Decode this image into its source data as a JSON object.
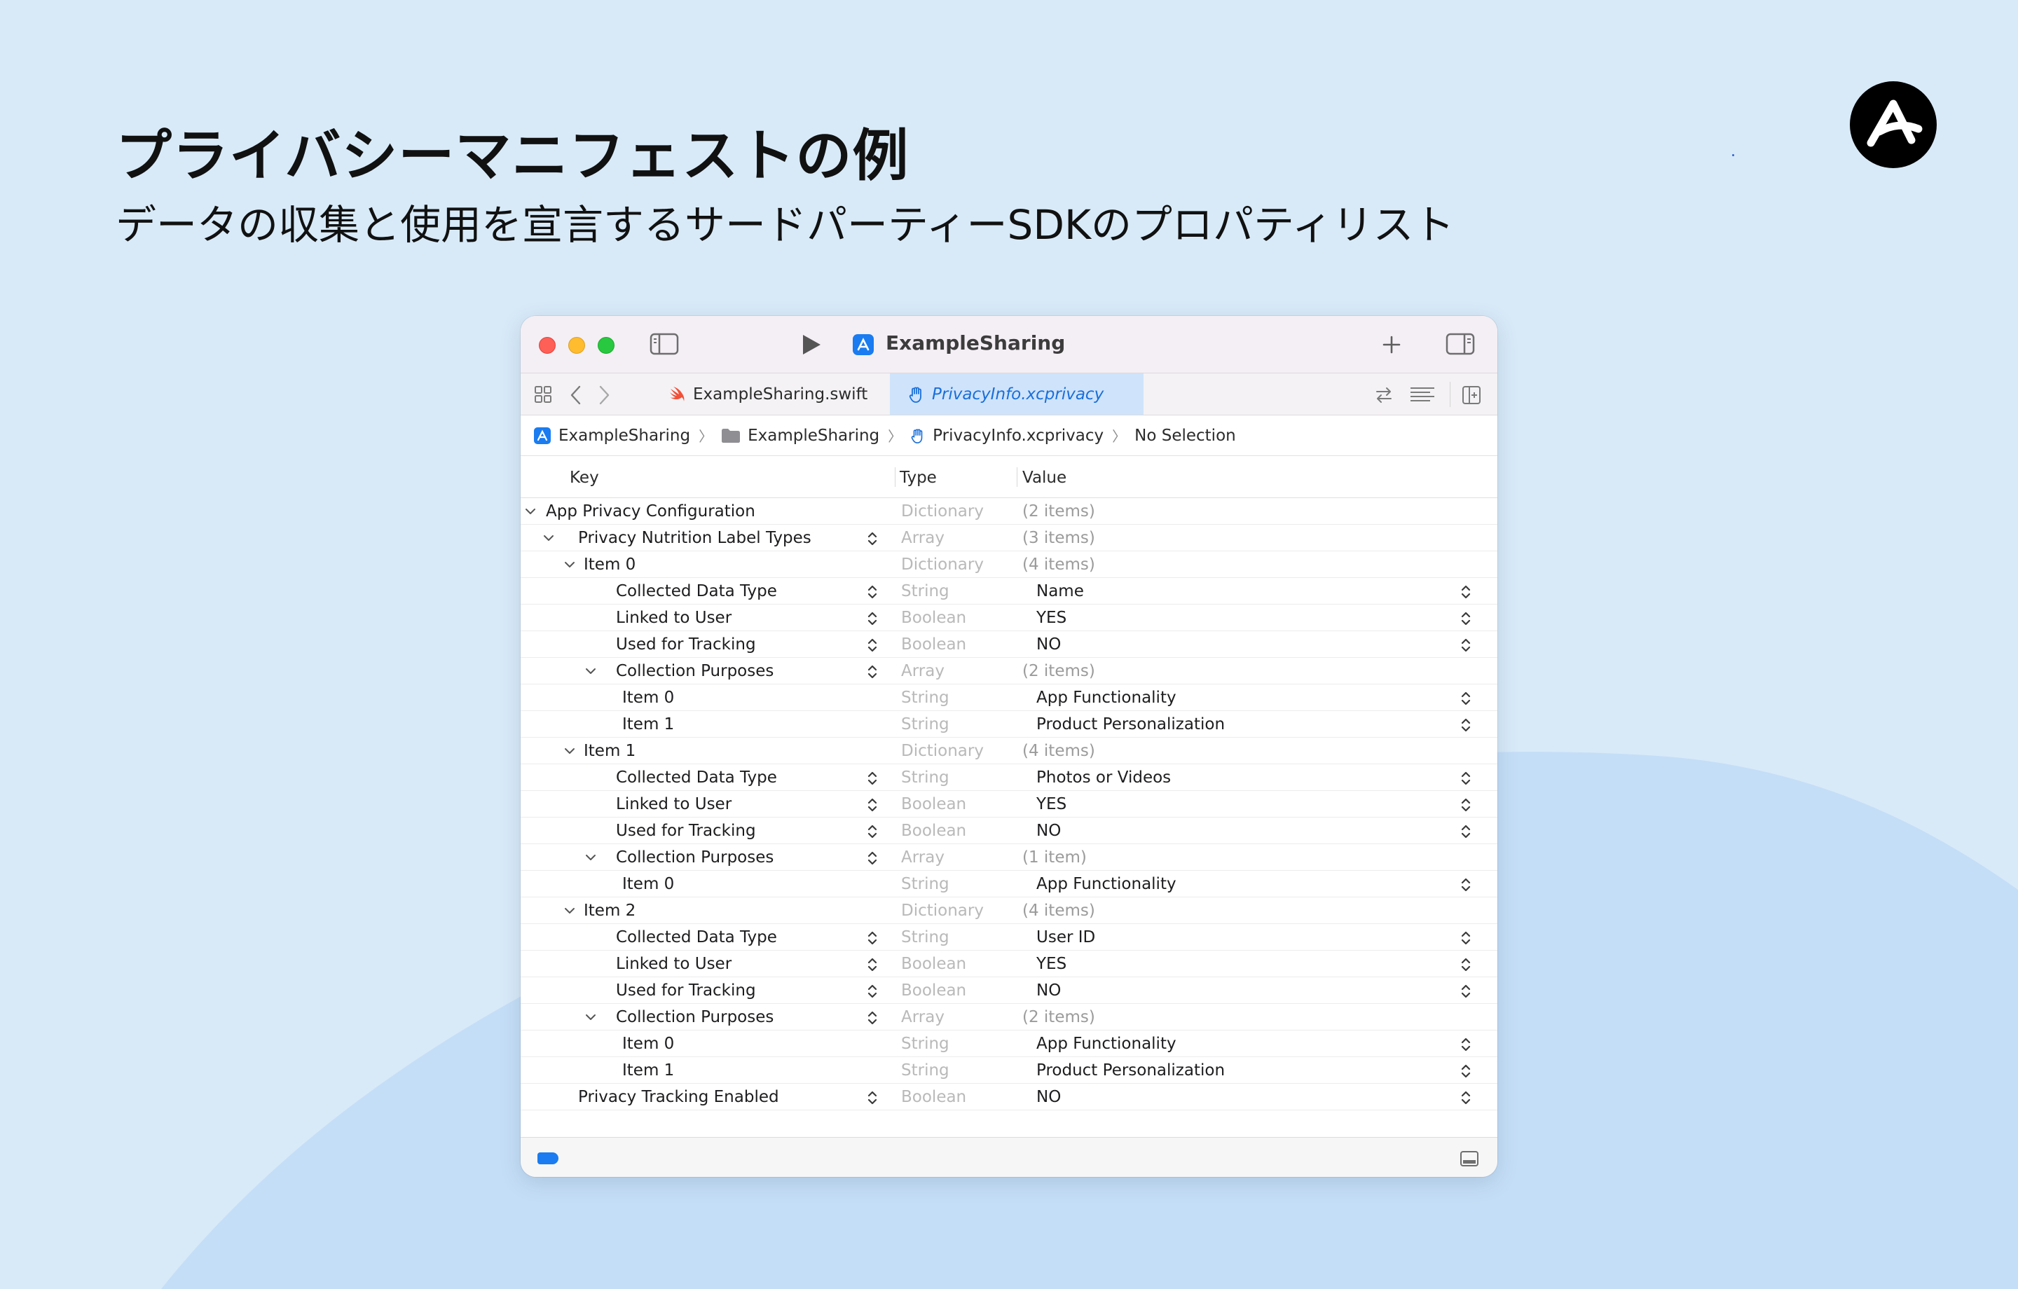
{
  "slide": {
    "title": "プライバシーマニフェストの例",
    "subtitle": "データの収集と使用を宣言するサードパーティーSDKのプロパティリスト",
    "logo_icon": "brand-logo-icon",
    "colors": {
      "background": "#d8eaf8",
      "accent": "#1a7cf0"
    }
  },
  "window": {
    "title": "ExampleSharing",
    "tabs": [
      {
        "label": "ExampleSharing.swift",
        "icon": "swift-icon",
        "active": false
      },
      {
        "label": "PrivacyInfo.xcprivacy",
        "icon": "privacy-hand-icon",
        "active": true
      }
    ],
    "breadcrumb": [
      {
        "label": "ExampleSharing",
        "icon": "app-icon"
      },
      {
        "label": "ExampleSharing",
        "icon": "folder-icon"
      },
      {
        "label": "PrivacyInfo.xcprivacy",
        "icon": "privacy-hand-icon"
      },
      {
        "label": "No Selection",
        "icon": ""
      }
    ],
    "columns": {
      "key": "Key",
      "type": "Type",
      "value": "Value"
    },
    "rows": [
      {
        "level": 0,
        "expandable": true,
        "key": "App Privacy Configuration",
        "type": "Dictionary",
        "value": "(2 items)",
        "meta": true,
        "key_stepper": false,
        "value_stepper": false
      },
      {
        "level": 1,
        "expandable": true,
        "key": "Privacy Nutrition Label Types",
        "type": "Array",
        "value": "(3 items)",
        "meta": true,
        "key_stepper": true,
        "value_stepper": false
      },
      {
        "level": 2,
        "expandable": true,
        "key": "Item 0",
        "type": "Dictionary",
        "value": "(4 items)",
        "meta": true,
        "key_stepper": false,
        "value_stepper": false
      },
      {
        "level": 3,
        "expandable": false,
        "key": "Collected Data Type",
        "type": "String",
        "value": "Name",
        "meta": false,
        "key_stepper": true,
        "value_stepper": true
      },
      {
        "level": 3,
        "expandable": false,
        "key": "Linked to User",
        "type": "Boolean",
        "value": "YES",
        "meta": false,
        "key_stepper": true,
        "value_stepper": true
      },
      {
        "level": 3,
        "expandable": false,
        "key": "Used for Tracking",
        "type": "Boolean",
        "value": "NO",
        "meta": false,
        "key_stepper": true,
        "value_stepper": true
      },
      {
        "level": 3,
        "expandable": true,
        "key": "Collection Purposes",
        "type": "Array",
        "value": "(2 items)",
        "meta": true,
        "key_stepper": true,
        "value_stepper": false
      },
      {
        "level": 4,
        "expandable": false,
        "key": "Item 0",
        "type": "String",
        "value": "App Functionality",
        "meta": false,
        "key_stepper": false,
        "value_stepper": true
      },
      {
        "level": 4,
        "expandable": false,
        "key": "Item 1",
        "type": "String",
        "value": "Product Personalization",
        "meta": false,
        "key_stepper": false,
        "value_stepper": true
      },
      {
        "level": 2,
        "expandable": true,
        "key": "Item 1",
        "type": "Dictionary",
        "value": "(4 items)",
        "meta": true,
        "key_stepper": false,
        "value_stepper": false
      },
      {
        "level": 3,
        "expandable": false,
        "key": "Collected Data Type",
        "type": "String",
        "value": "Photos or Videos",
        "meta": false,
        "key_stepper": true,
        "value_stepper": true
      },
      {
        "level": 3,
        "expandable": false,
        "key": "Linked to User",
        "type": "Boolean",
        "value": "YES",
        "meta": false,
        "key_stepper": true,
        "value_stepper": true
      },
      {
        "level": 3,
        "expandable": false,
        "key": "Used for Tracking",
        "type": "Boolean",
        "value": "NO",
        "meta": false,
        "key_stepper": true,
        "value_stepper": true
      },
      {
        "level": 3,
        "expandable": true,
        "key": "Collection Purposes",
        "type": "Array",
        "value": "(1 item)",
        "meta": true,
        "key_stepper": true,
        "value_stepper": false
      },
      {
        "level": 4,
        "expandable": false,
        "key": "Item 0",
        "type": "String",
        "value": "App Functionality",
        "meta": false,
        "key_stepper": false,
        "value_stepper": true
      },
      {
        "level": 2,
        "expandable": true,
        "key": "Item 2",
        "type": "Dictionary",
        "value": "(4 items)",
        "meta": true,
        "key_stepper": false,
        "value_stepper": false
      },
      {
        "level": 3,
        "expandable": false,
        "key": "Collected Data Type",
        "type": "String",
        "value": "User ID",
        "meta": false,
        "key_stepper": true,
        "value_stepper": true
      },
      {
        "level": 3,
        "expandable": false,
        "key": "Linked to User",
        "type": "Boolean",
        "value": "YES",
        "meta": false,
        "key_stepper": true,
        "value_stepper": true
      },
      {
        "level": 3,
        "expandable": false,
        "key": "Used for Tracking",
        "type": "Boolean",
        "value": "NO",
        "meta": false,
        "key_stepper": true,
        "value_stepper": true
      },
      {
        "level": 3,
        "expandable": true,
        "key": "Collection Purposes",
        "type": "Array",
        "value": "(2 items)",
        "meta": true,
        "key_stepper": true,
        "value_stepper": false
      },
      {
        "level": 4,
        "expandable": false,
        "key": "Item 0",
        "type": "String",
        "value": "App Functionality",
        "meta": false,
        "key_stepper": false,
        "value_stepper": true
      },
      {
        "level": 4,
        "expandable": false,
        "key": "Item 1",
        "type": "String",
        "value": "Product Personalization",
        "meta": false,
        "key_stepper": false,
        "value_stepper": true
      },
      {
        "level": 1,
        "expandable": false,
        "key": "Privacy Tracking Enabled",
        "type": "Boolean",
        "value": "NO",
        "meta": false,
        "key_stepper": true,
        "value_stepper": true
      }
    ]
  }
}
